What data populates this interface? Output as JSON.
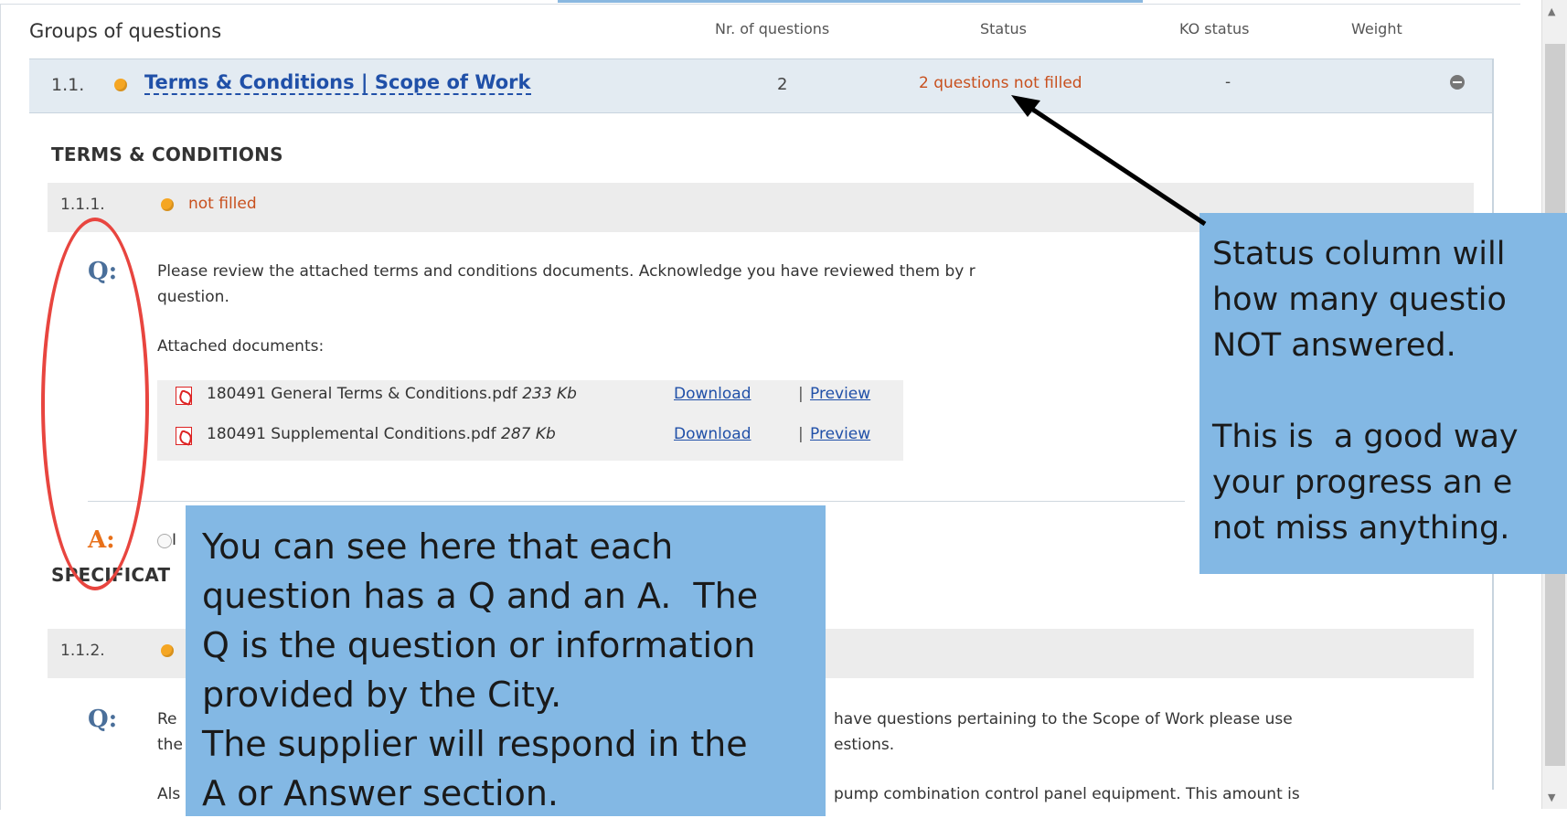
{
  "header": {
    "groups_label": "Groups of questions",
    "col_nr_questions": "Nr. of questions",
    "col_status": "Status",
    "col_ko_status": "KO status",
    "col_weight": "Weight"
  },
  "group": {
    "number": "1.1.",
    "title": "Terms & Conditions | Scope of Work",
    "nr_questions": "2",
    "status": "2 questions not filled",
    "ko_status": "-"
  },
  "sections": [
    {
      "title": "TERMS & CONDITIONS",
      "question": {
        "number": "1.1.1.",
        "status": "not filled",
        "q_label": "Q:",
        "q_text_line1": "Please review the attached terms and conditions documents.  Acknowledge you have reviewed them by r",
        "q_text_line2": "question.",
        "attached_label": "Attached documents:",
        "attachments": [
          {
            "name": "180491 General Terms & Conditions.pdf",
            "size": "233 Kb",
            "download": "Download",
            "preview": "Preview",
            "sep": "|"
          },
          {
            "name": "180491 Supplemental Conditions.pdf",
            "size": "287 Kb",
            "download": "Download",
            "preview": "Preview",
            "sep": "|"
          }
        ],
        "a_label": "A:",
        "a_partial": "I"
      }
    },
    {
      "title": "SPECIFICAT",
      "question": {
        "number": "1.1.2.",
        "q_label": "Q:",
        "q_text_line1_start": "Re",
        "q_text_line1_end": "have questions pertaining to the Scope of Work please use",
        "q_text_line2_start": "the",
        "q_text_line2_end": "estions.",
        "q_text_line3_start": "Als",
        "q_text_line3_end": "pump combination control panel equipment.  This amount is"
      }
    }
  ],
  "callouts": {
    "left": "You can see here that each\nquestion has a Q and an A.  The\nQ is the question or information\nprovided by the City.\nThe supplier will respond in the\nA or Answer section.",
    "right": "Status column will\nhow many questio\nNOT answered.\n\nThis is  a good way\nyour progress an e\nnot miss anything."
  },
  "colors": {
    "callout_bg": "#83b8e4",
    "status_orange": "#c8501e",
    "dot_orange": "#f5a623",
    "link_blue": "#2050a8",
    "ellipse_red": "#e8453f"
  }
}
